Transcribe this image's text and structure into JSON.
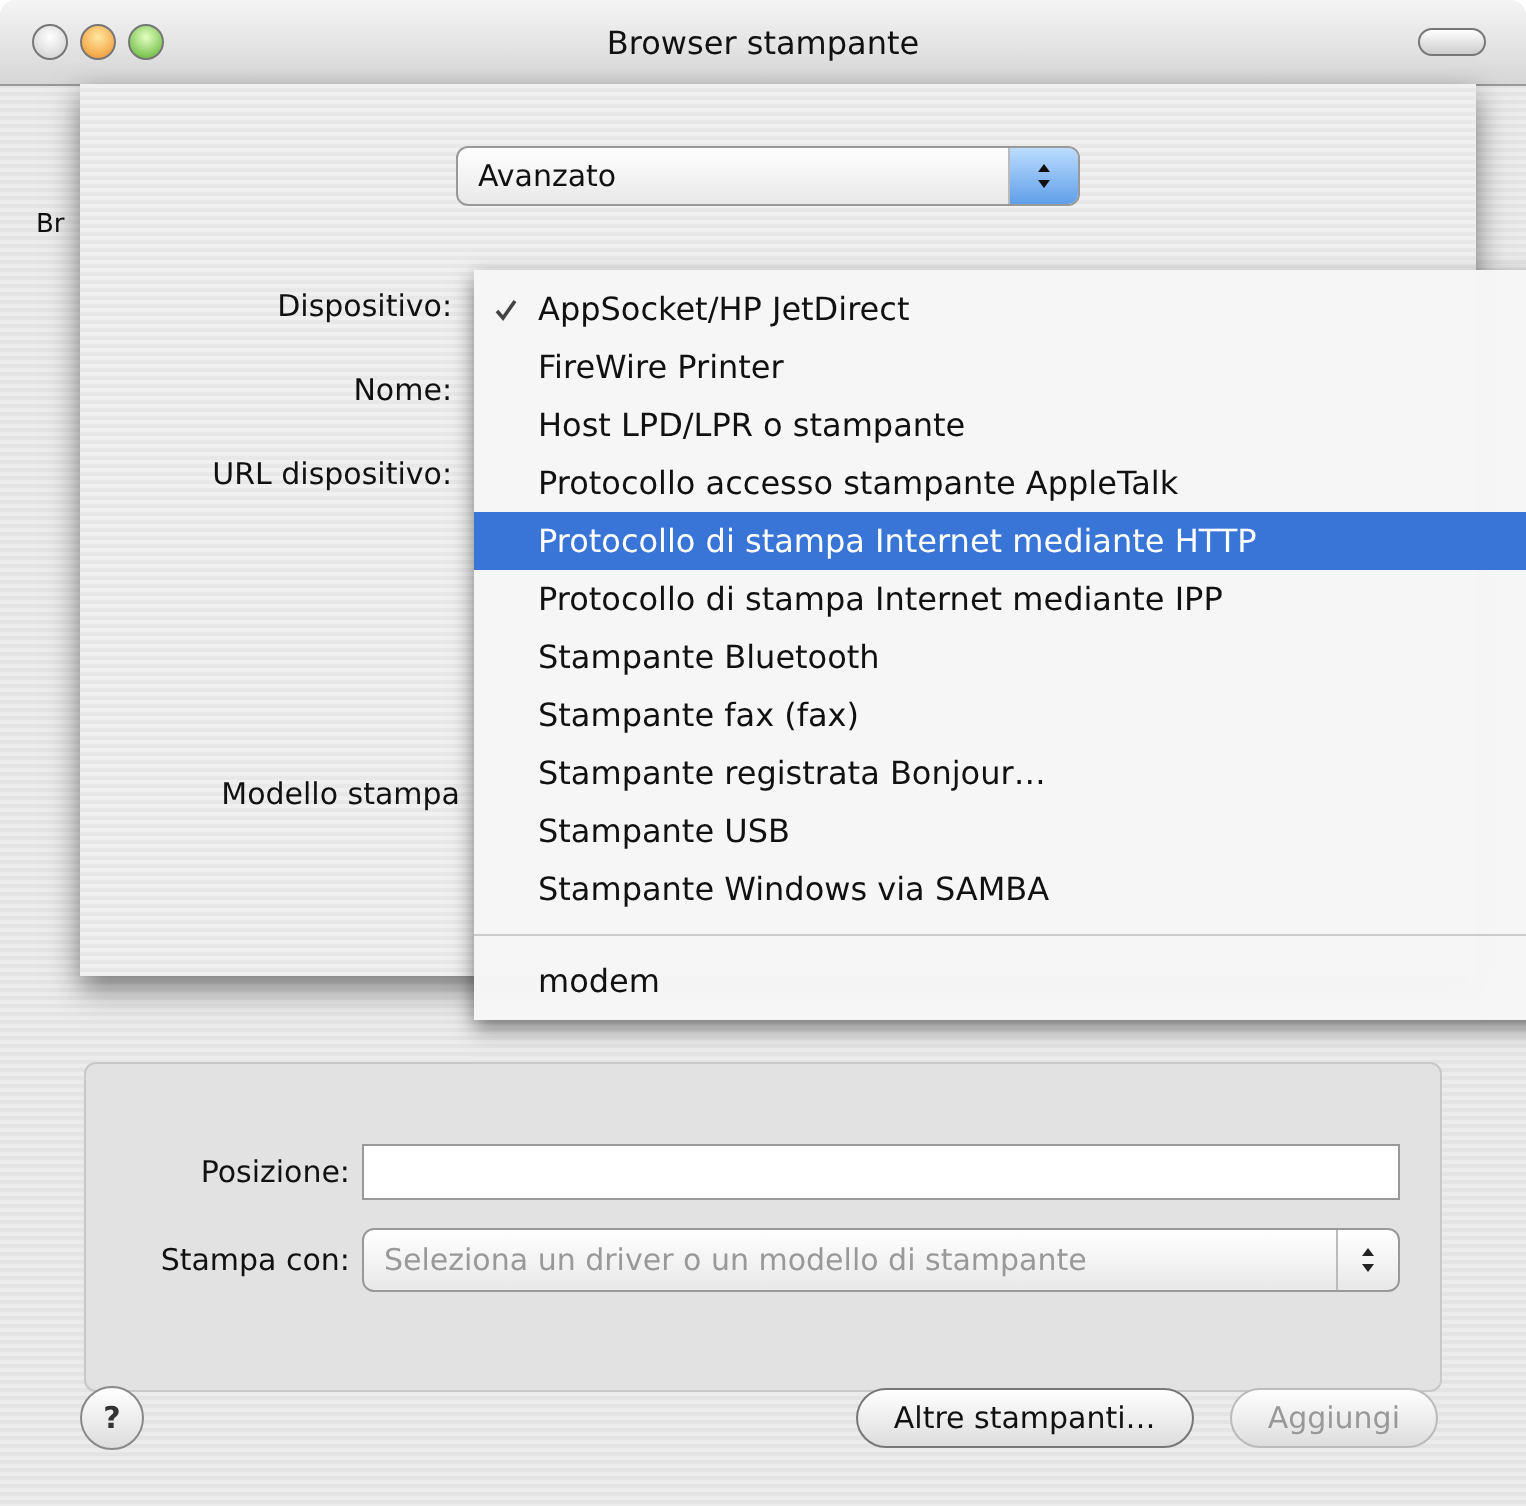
{
  "window": {
    "title": "Browser stampante"
  },
  "background_tab": {
    "label": "Br"
  },
  "sheet": {
    "view_popup": {
      "value": "Avanzato"
    },
    "labels": [
      "Dispositivo:",
      "Nome:",
      "URL dispositivo:",
      "Modello stampa"
    ]
  },
  "menu": {
    "items": [
      {
        "label": "AppSocket/HP JetDirect",
        "checked": true,
        "selected": false
      },
      {
        "label": "FireWire Printer",
        "checked": false,
        "selected": false
      },
      {
        "label": "Host LPD/LPR o stampante",
        "checked": false,
        "selected": false
      },
      {
        "label": "Protocollo accesso stampante AppleTalk",
        "checked": false,
        "selected": false
      },
      {
        "label": "Protocollo di stampa Internet mediante HTTP",
        "checked": false,
        "selected": true
      },
      {
        "label": "Protocollo di stampa Internet mediante IPP",
        "checked": false,
        "selected": false
      },
      {
        "label": "Stampante Bluetooth",
        "checked": false,
        "selected": false
      },
      {
        "label": "Stampante fax (fax)",
        "checked": false,
        "selected": false
      },
      {
        "label": "Stampante registrata Bonjour…",
        "checked": false,
        "selected": false
      },
      {
        "label": "Stampante USB",
        "checked": false,
        "selected": false
      },
      {
        "label": "Stampante Windows via SAMBA",
        "checked": false,
        "selected": false
      }
    ],
    "footer_items": [
      {
        "label": "modem",
        "checked": false,
        "selected": false
      }
    ]
  },
  "form": {
    "position": {
      "label": "Posizione:"
    },
    "print_with": {
      "label": "Stampa con:",
      "placeholder": "Seleziona un driver o un modello di stampante",
      "disabled": true
    }
  },
  "help_button": {
    "label": "?"
  },
  "buttons": [
    {
      "label": "Altre stampanti…",
      "disabled": false
    },
    {
      "label": "Aggiungi",
      "disabled": true
    }
  ]
}
